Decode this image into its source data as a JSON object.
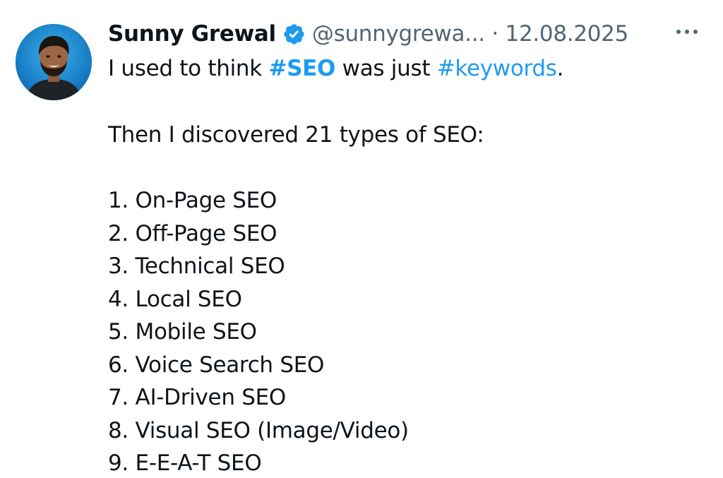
{
  "tweet": {
    "author_name": "Sunny Grewal",
    "handle": "@sunnygrewa...",
    "separator": " · ",
    "date": "12.08.2025",
    "verified_icon": "verified-badge-icon",
    "more_icon": "more-options-icon",
    "intro": {
      "part1": "I used to think ",
      "tag1": "#SEO",
      "part2": " was just ",
      "tag2": "#keywords",
      "part3": "."
    },
    "lead": "Then I discovered 21 types of SEO:",
    "list": [
      "1. On-Page SEO",
      "2. Off-Page SEO",
      "3. Technical SEO",
      "4. Local SEO",
      "5. Mobile SEO",
      "6. Voice Search SEO",
      "7. AI-Driven SEO",
      "8. Visual SEO (Image/Video)",
      "9. E-E-A-T SEO"
    ],
    "colors": {
      "hashtag": "#1d9bf0",
      "verified": "#1d9bf0",
      "text": "#0f1419",
      "muted": "#536471"
    }
  }
}
